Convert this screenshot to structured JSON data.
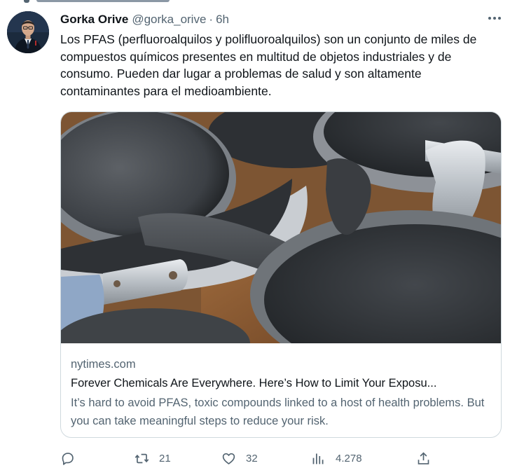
{
  "tweet": {
    "author": {
      "name": "Gorka Orive",
      "handle": "@gorka_orive"
    },
    "separator": "·",
    "time": "6h",
    "text": "Los PFAS (perfluoroalquilos y polifluoroalquilos) son un conjunto de miles de compuestos químicos presentes en multitud de objetos industriales y de consumo. Pueden dar lugar a problemas de salud y son altamente contaminantes para el medioambiente.",
    "more_icon": "more-horizontal-icon"
  },
  "card": {
    "domain": "nytimes.com",
    "title": "Forever Chemicals Are Everywhere. Here’s How to Limit Your Exposu...",
    "description": "It’s hard to avoid PFAS, toxic compounds linked to a host of health problems. But you can take meaningful steps to reduce your risk."
  },
  "actions": {
    "reply": {
      "icon": "reply-icon"
    },
    "retweet": {
      "icon": "retweet-icon",
      "count": "21"
    },
    "like": {
      "icon": "heart-icon",
      "count": "32"
    },
    "views": {
      "icon": "views-chart-icon",
      "count": "4.278"
    },
    "share": {
      "icon": "share-icon"
    }
  },
  "colors": {
    "text_primary": "#0f1419",
    "text_secondary": "#536471",
    "border": "#cfd9de"
  }
}
